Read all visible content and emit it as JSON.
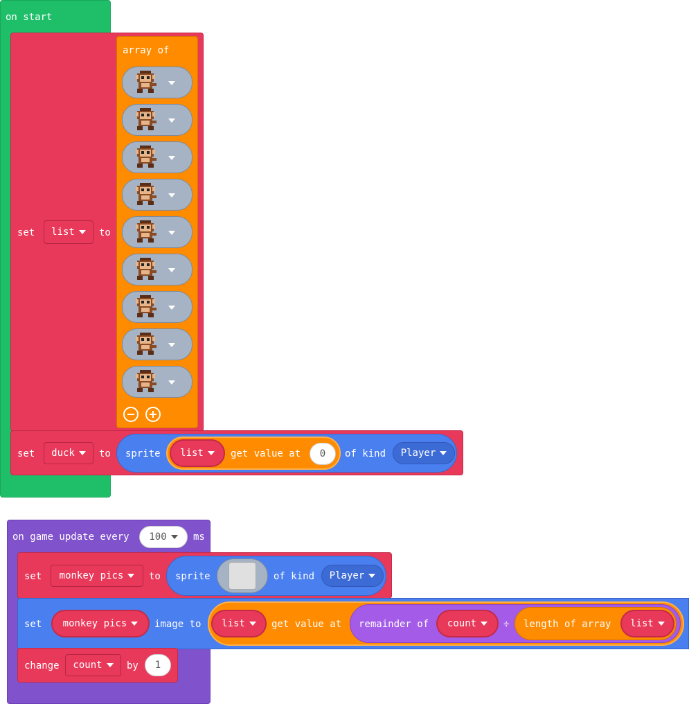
{
  "on_start": {
    "hat_label": "on start",
    "set_list": {
      "set_label": "set",
      "variable": "list",
      "to_label": "to",
      "array_label": "array of",
      "images": [
        "monkey-sprite",
        "monkey-sprite",
        "monkey-sprite",
        "monkey-sprite",
        "monkey-sprite",
        "monkey-sprite",
        "monkey-sprite",
        "monkey-sprite",
        "monkey-sprite"
      ]
    },
    "set_duck": {
      "set_label": "set",
      "variable": "duck",
      "to_label": "to",
      "sprite_label": "sprite",
      "list_var": "list",
      "get_value_label": "get value at",
      "index": "0",
      "of_kind_label": "of kind",
      "kind": "Player"
    }
  },
  "on_game_update": {
    "hat_label": "on game update every",
    "interval": "100",
    "unit": "ms",
    "set_monkey": {
      "set_label": "set",
      "variable": "monkey pics",
      "to_label": "to",
      "sprite_label": "sprite",
      "of_kind_label": "of kind",
      "kind": "Player"
    },
    "set_image": {
      "set_label": "set",
      "variable": "monkey pics",
      "image_to_label": "image to",
      "list_var": "list",
      "get_value_label": "get value at",
      "remainder_label": "remainder of",
      "count_var": "count",
      "divide_symbol": "÷",
      "length_label": "length of array",
      "length_var": "list"
    },
    "change_count": {
      "change_label": "change",
      "variable": "count",
      "by_label": "by",
      "amount": "1"
    }
  },
  "colors": {
    "events": "#1fbf6a",
    "variables": "#e9395a",
    "arrays": "#ff8b00",
    "sprites": "#4a7ff0",
    "game": "#8052cc",
    "math": "#a35be8"
  }
}
